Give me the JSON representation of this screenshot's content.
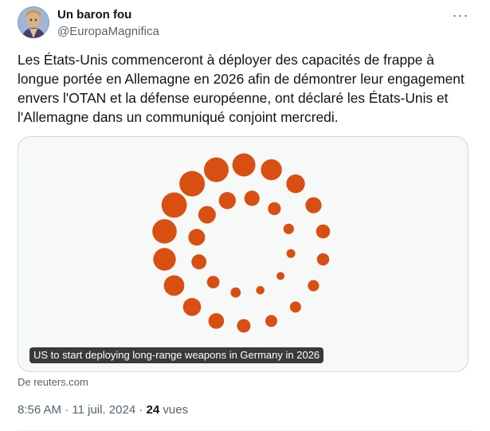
{
  "author": {
    "display_name": "Un baron fou",
    "handle": "@EuropaMagnifica",
    "avatar_icon": "portrait-avatar"
  },
  "more_icon": "more-horizontal-icon",
  "more_glyph": "···",
  "tweet": {
    "text": "Les États-Unis commenceront à déployer des capacités de frappe à longue portée en Allemagne en 2026 afin de démontrer leur engagement envers l'OTAN et la défense européenne, ont déclaré les États-Unis et l'Allemagne dans un communiqué conjoint mercredi."
  },
  "link_card": {
    "image_icon": "reuters-logo",
    "accent_color": "#d94f12",
    "caption": "US to start deploying long-range weapons in Germany in 2026",
    "source": "De reuters.com"
  },
  "meta": {
    "time": "8:56 AM",
    "separator": "·",
    "date": "11 juil. 2024",
    "views_count": "24",
    "views_label": "vues"
  }
}
